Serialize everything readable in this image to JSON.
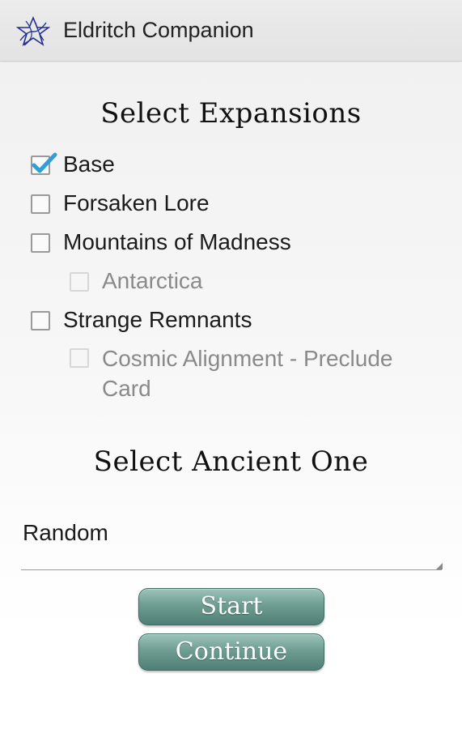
{
  "actionbar": {
    "title": "Eldritch Companion",
    "icon": "elder-sign-icon"
  },
  "expansions": {
    "heading": "Select Expansions",
    "items": [
      {
        "label": "Base",
        "checked": true,
        "enabled": true
      },
      {
        "label": "Forsaken Lore",
        "checked": false,
        "enabled": true
      },
      {
        "label": "Mountains of Madness",
        "checked": false,
        "enabled": true
      },
      {
        "label": "Antarctica",
        "checked": false,
        "enabled": false
      },
      {
        "label": "Strange Remnants",
        "checked": false,
        "enabled": true
      },
      {
        "label": "Cosmic Alignment - Preclude Card",
        "checked": false,
        "enabled": false
      }
    ]
  },
  "ancient_one": {
    "heading": "Select Ancient One",
    "selected": "Random"
  },
  "buttons": {
    "start": "Start",
    "continue": "Continue"
  },
  "colors": {
    "check_accent": "#2f9fd6",
    "button_teal": "#6f9d92",
    "actionbar_bg": "#e6e6e6"
  }
}
